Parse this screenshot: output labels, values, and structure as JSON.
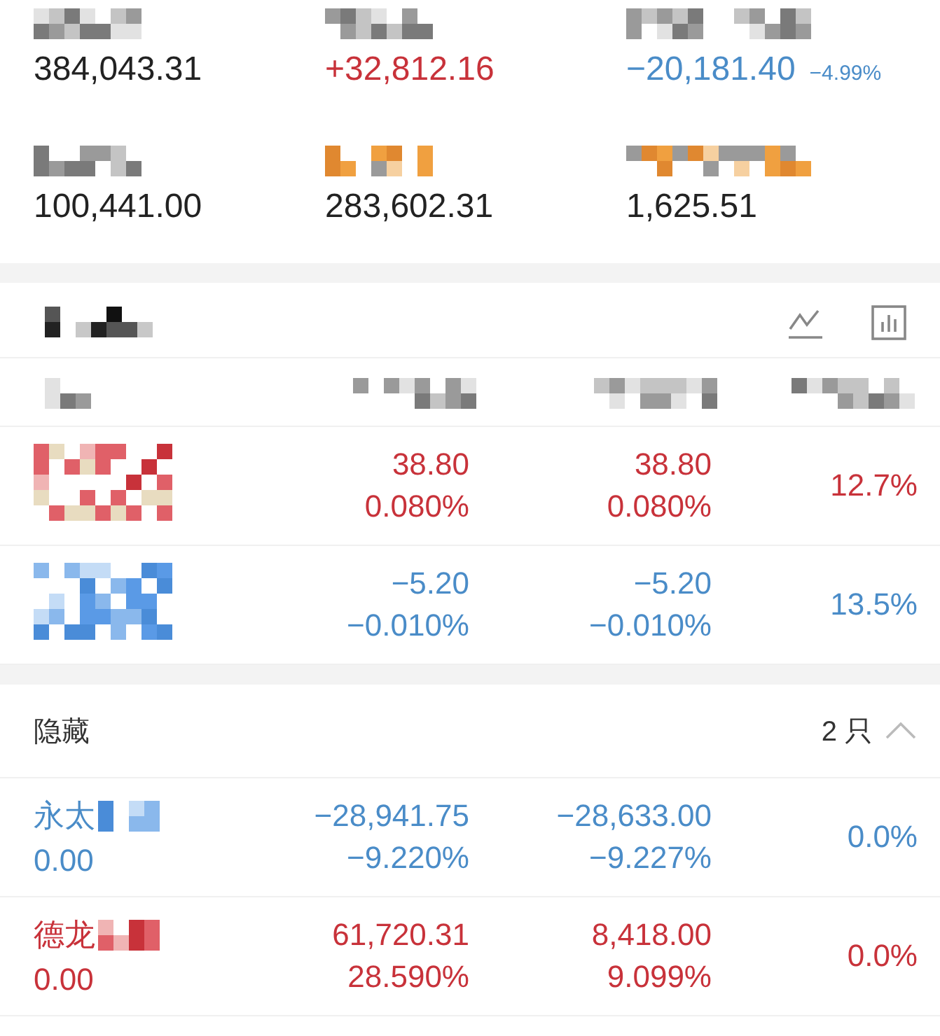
{
  "summary": [
    {
      "value": "384,043.31",
      "color": "#222222"
    },
    {
      "value": "+32,812.16",
      "color": "#c8323a"
    },
    {
      "value": "−20,181.40",
      "color": "#4a8cc8",
      "change": "−4.99%"
    },
    {
      "value": "100,441.00",
      "color": "#222222"
    },
    {
      "value": "283,602.31",
      "color": "#222222"
    },
    {
      "value": "1,625.51",
      "color": "#222222"
    }
  ],
  "holdings": [
    {
      "color": "#c8323a",
      "col2": [
        "38.80",
        "0.080%"
      ],
      "col3": [
        "38.80",
        "0.080%"
      ],
      "col4": "12.7%"
    },
    {
      "color": "#4a8cc8",
      "col2": [
        "−5.20",
        "−0.010%"
      ],
      "col3": [
        "−5.20",
        "−0.010%"
      ],
      "col4": "13.5%"
    }
  ],
  "hidden_section": {
    "title": "隐藏",
    "count": "2 只",
    "expanded": true
  },
  "hidden_rows": [
    {
      "color": "#4a8cc8",
      "name": "永太",
      "sub": "0.00",
      "col2": [
        "−28,941.75",
        "−9.220%"
      ],
      "col3": [
        "−28,633.00",
        "−9.227%"
      ],
      "col4": "0.0%"
    },
    {
      "color": "#c8323a",
      "name": "德龙",
      "sub": "0.00",
      "col2": [
        "61,720.31",
        "28.590%"
      ],
      "col3": [
        "8,418.00",
        "9.099%"
      ],
      "col4": "0.0%"
    }
  ]
}
